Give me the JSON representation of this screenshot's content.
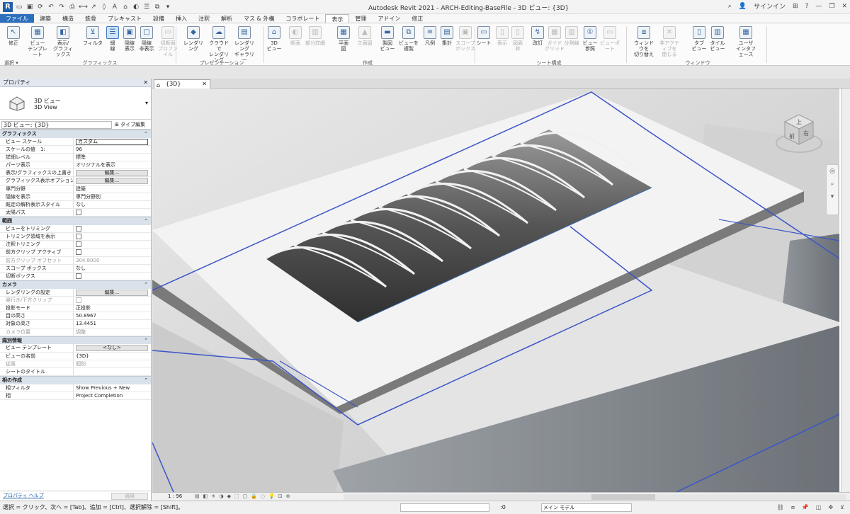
{
  "app_title": "Autodesk Revit 2021 - ARCH-Editing-BaseFile - 3D ビュー: {3D}",
  "signin": "サインイン",
  "tabs": [
    "ファイル",
    "建築",
    "構造",
    "鉄骨",
    "プレキャスト",
    "設備",
    "挿入",
    "注釈",
    "解析",
    "マス & 外構",
    "コラボレート",
    "表示",
    "管理",
    "アドイン",
    "修正"
  ],
  "active_tab": "表示",
  "ribbon": {
    "buttons": [
      "修正",
      "ビュー\nテンプレート",
      "表示/\nグラフィックス",
      "フィルタ",
      "細\n線",
      "隠線\n表示",
      "隠線\n非表示",
      "切断面\nプロファイル",
      "レンダリング",
      "クラウドで\nレンダリング",
      "レンダリング\nギャラリー",
      "3D\nビュー",
      "断面",
      "部分詳細",
      "平面\n図",
      "立面図",
      "製図\nビュー",
      "ビューを\n複製",
      "凡例",
      "集計",
      "スコープ\nボックス",
      "シート",
      "表示",
      "図面\n枠",
      "改訂",
      "ガイド\nグリッド",
      "分割線",
      "ビュー\n参照",
      "ビューポート",
      "ウィンドウを\n切り替え",
      "非アクティブを\n閉じる",
      "タブ\nビュー",
      "タイル\nビュー",
      "ユーザ\nインタフェース"
    ],
    "select_label": "選択",
    "groups": [
      "グラフィックス",
      "プレゼンテーション",
      "作成",
      "シート構成",
      "ウィンドウ"
    ]
  },
  "properties": {
    "title": "プロパティ",
    "type_name": "3D ビュー",
    "type_sub": "3D View",
    "view_selector": "3D ビュー: {3D}",
    "type_edit": "タイプ編集",
    "sections": [
      {
        "name": "グラフィックス",
        "rows": [
          {
            "k": "ビュー スケール",
            "v": "カスタム",
            "kind": "input"
          },
          {
            "k": "スケールの値　1:",
            "v": "96"
          },
          {
            "k": "詳細レベル",
            "v": "標準"
          },
          {
            "k": "パーツ表示",
            "v": "オリジナルを表示"
          },
          {
            "k": "表示/グラフィックスの上書き",
            "v": "編集...",
            "kind": "btn"
          },
          {
            "k": "グラフィックス表示オプション",
            "v": "編集...",
            "kind": "btn"
          },
          {
            "k": "専門分野",
            "v": "建築"
          },
          {
            "k": "隠線を表示",
            "v": "専門分野別"
          },
          {
            "k": "既定の解析表示スタイル",
            "v": "なし"
          },
          {
            "k": "太陽パス",
            "v": "",
            "kind": "cb"
          }
        ]
      },
      {
        "name": "範囲",
        "rows": [
          {
            "k": "ビューをトリミング",
            "v": "",
            "kind": "cb"
          },
          {
            "k": "トリミング領域を表示",
            "v": "",
            "kind": "cb"
          },
          {
            "k": "注釈トリミング",
            "v": "",
            "kind": "cb"
          },
          {
            "k": "前方クリップ アクティブ",
            "v": "",
            "kind": "cb"
          },
          {
            "k": "前方クリップ オフセット",
            "v": "304.8000",
            "dim": true
          },
          {
            "k": "スコープ ボックス",
            "v": "なし"
          },
          {
            "k": "切断ボックス",
            "v": "",
            "kind": "cb"
          }
        ]
      },
      {
        "name": "カメラ",
        "rows": [
          {
            "k": "レンダリングの設定",
            "v": "編集...",
            "kind": "btn"
          },
          {
            "k": "奥行き/下方クリップ",
            "v": "",
            "kind": "cbdim",
            "dim": true
          },
          {
            "k": "投影モード",
            "v": "正投影"
          },
          {
            "k": "目の高さ",
            "v": "50.8967"
          },
          {
            "k": "対象の高さ",
            "v": "13.4451"
          },
          {
            "k": "カメラ位置",
            "v": "調整",
            "dim": true
          }
        ]
      },
      {
        "name": "識別情報",
        "rows": [
          {
            "k": "ビュー テンプレート",
            "v": "<なし>",
            "kind": "btn"
          },
          {
            "k": "ビューの名前",
            "v": "{3D}"
          },
          {
            "k": "従属",
            "v": "個別",
            "dim": true
          },
          {
            "k": "シートのタイトル",
            "v": ""
          }
        ]
      },
      {
        "name": "相の作成",
        "rows": [
          {
            "k": "相フィルタ",
            "v": "Show Previous + New"
          },
          {
            "k": "相",
            "v": "Project Completion"
          }
        ]
      }
    ],
    "help": "プロパティ ヘルプ",
    "apply": "適用"
  },
  "view_tab": "{3D}",
  "navcube": {
    "top": "上",
    "front": "前",
    "right": "右"
  },
  "view_control": {
    "scale": "1 : 96"
  },
  "status": {
    "message": "選択 = クリック、次へ = [Tab]、追加 = [Ctrl]、選択解除 = [Shift]。",
    "zero": ":0",
    "model": "メイン モデル"
  }
}
